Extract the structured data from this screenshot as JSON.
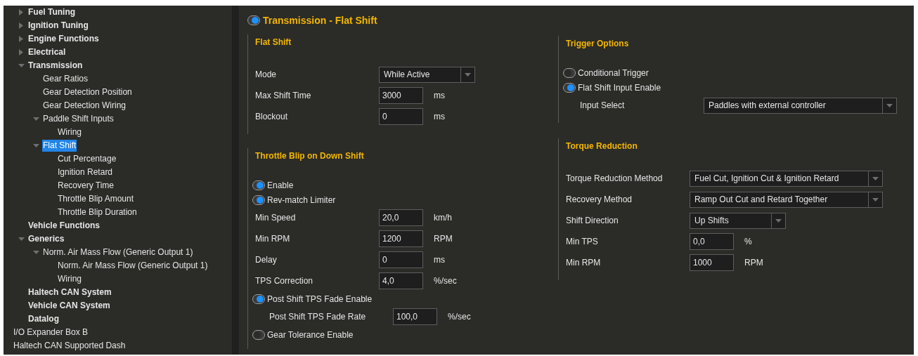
{
  "sidebar": {
    "items": [
      {
        "children": [
          {
            "label": "Fuel Tuning",
            "expanded": false,
            "selected": false
          },
          {
            "label": "Ignition Tuning",
            "expanded": false,
            "selected": false
          },
          {
            "label": "Engine Functions",
            "expanded": false,
            "selected": false
          },
          {
            "label": "Electrical",
            "expanded": false,
            "selected": false
          },
          {
            "label": "Transmission",
            "expanded": true,
            "selected": false,
            "children": [
              {
                "label": "Gear Ratios",
                "selected": false
              },
              {
                "label": "Gear Detection Position",
                "selected": false
              },
              {
                "label": "Gear Detection Wiring",
                "selected": false
              },
              {
                "label": "Paddle Shift Inputs",
                "expanded": true,
                "selected": false,
                "children": [
                  {
                    "label": "Wiring",
                    "selected": false
                  }
                ]
              },
              {
                "label": "Flat Shift",
                "expanded": true,
                "selected": true,
                "children": [
                  {
                    "label": "Cut Percentage",
                    "selected": false
                  },
                  {
                    "label": "Ignition Retard",
                    "selected": false
                  },
                  {
                    "label": "Recovery Time",
                    "selected": false
                  },
                  {
                    "label": "Throttle Blip Amount",
                    "selected": false
                  },
                  {
                    "label": "Throttle Blip Duration",
                    "selected": false
                  }
                ]
              }
            ]
          },
          {
            "label": "Vehicle Functions",
            "selected": false
          },
          {
            "label": "Generics",
            "expanded": true,
            "selected": false,
            "children": [
              {
                "label": "Norm. Air Mass Flow (Generic Output 1)",
                "expanded": true,
                "selected": false,
                "children": [
                  {
                    "label": "Norm. Air Mass Flow (Generic Output 1)",
                    "selected": false
                  },
                  {
                    "label": "Wiring",
                    "selected": false
                  }
                ]
              }
            ]
          },
          {
            "label": "Haltech CAN System",
            "selected": false
          },
          {
            "label": "Vehicle CAN System",
            "selected": false
          },
          {
            "label": "Datalog",
            "selected": false
          }
        ]
      },
      {
        "label": "I/O Expander Box B",
        "selected": false
      },
      {
        "label": "Haltech CAN Supported Dash",
        "selected": false
      }
    ]
  },
  "panel": {
    "title": "Transmission - Flat Shift",
    "on": true,
    "columns": [
      {
        "sections": [
          {
            "title": "Flat Shift",
            "rows": [
              {
                "kind": "select",
                "label": "Mode",
                "value": "While Active"
              },
              {
                "kind": "number",
                "label": "Max Shift Time",
                "value": "3000",
                "unit": "ms"
              },
              {
                "kind": "number",
                "label": "Blockout",
                "value": "0",
                "unit": "ms"
              }
            ]
          },
          {
            "title": "Throttle Blip on Down Shift",
            "rows": [
              {
                "kind": "toggle",
                "label": "Enable",
                "on": true
              },
              {
                "kind": "toggle",
                "label": "Rev-match Limiter",
                "on": true
              },
              {
                "kind": "number",
                "label": "Min Speed",
                "value": "20,0",
                "unit": "km/h"
              },
              {
                "kind": "number",
                "label": "Min RPM",
                "value": "1200",
                "unit": "RPM"
              },
              {
                "kind": "number",
                "label": "Delay",
                "value": "0",
                "unit": "ms"
              },
              {
                "kind": "number",
                "label": "TPS Correction",
                "value": "4,0",
                "unit": "%/sec"
              },
              {
                "kind": "toggle",
                "label": "Post Shift TPS Fade Enable",
                "on": true,
                "children": [
                  {
                    "kind": "number",
                    "label": "Post Shift TPS Fade Rate",
                    "value": "100,0",
                    "unit": "%/sec"
                  }
                ]
              },
              {
                "kind": "toggle",
                "label": "Gear Tolerance Enable",
                "on": false
              }
            ]
          }
        ]
      },
      {
        "sections": [
          {
            "title": "Trigger Options",
            "rows": [
              {
                "kind": "toggle",
                "label": "Conditional Trigger",
                "on": false
              },
              {
                "kind": "toggle",
                "label": "Flat Shift Input Enable",
                "on": true,
                "children": [
                  {
                    "kind": "select",
                    "label": "Input Select",
                    "value": "Paddles with external controller"
                  }
                ]
              }
            ]
          },
          {
            "title": "Torque Reduction",
            "rows": [
              {
                "kind": "select",
                "label": "Torque Reduction Method",
                "value": "Fuel Cut, Ignition Cut & Ignition Retard"
              },
              {
                "kind": "select",
                "label": "Recovery Method",
                "value": "Ramp Out Cut and Retard Together"
              },
              {
                "kind": "select",
                "label": "Shift Direction",
                "value": "Up Shifts"
              },
              {
                "kind": "number",
                "label": "Min TPS",
                "value": "0,0",
                "unit": "%"
              },
              {
                "kind": "number",
                "label": "Min RPM",
                "value": "1000",
                "unit": "RPM"
              }
            ]
          }
        ]
      }
    ]
  }
}
